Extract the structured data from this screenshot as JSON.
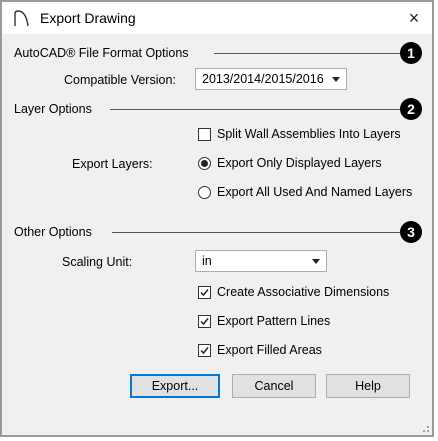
{
  "window": {
    "title": "Export Drawing",
    "close_glyph": "×"
  },
  "sections": {
    "autocad": {
      "label": "AutoCAD® File Format Options",
      "badge": "1",
      "compatible_version_label": "Compatible Version:",
      "compatible_version_value": "2013/2014/2015/2016"
    },
    "layer": {
      "label": "Layer Options",
      "badge": "2",
      "split_wall_label": "Split Wall Assemblies Into Layers",
      "split_wall_checked": false,
      "export_layers_label": "Export Layers:",
      "radio_displayed_label": "Export Only Displayed Layers",
      "radio_all_label": "Export All Used And Named Layers",
      "selected_radio": "displayed"
    },
    "other": {
      "label": "Other Options",
      "badge": "3",
      "scaling_unit_label": "Scaling Unit:",
      "scaling_unit_value": "in",
      "assoc_dims_label": "Create Associative Dimensions",
      "assoc_dims_checked": true,
      "pattern_lines_label": "Export Pattern Lines",
      "pattern_lines_checked": true,
      "filled_areas_label": "Export Filled Areas",
      "filled_areas_checked": true
    }
  },
  "buttons": {
    "export": "Export...",
    "cancel": "Cancel",
    "help": "Help"
  },
  "colors": {
    "accent": "#0078d7",
    "dialog_bg": "#f0f0f0",
    "badge": "#000000"
  }
}
